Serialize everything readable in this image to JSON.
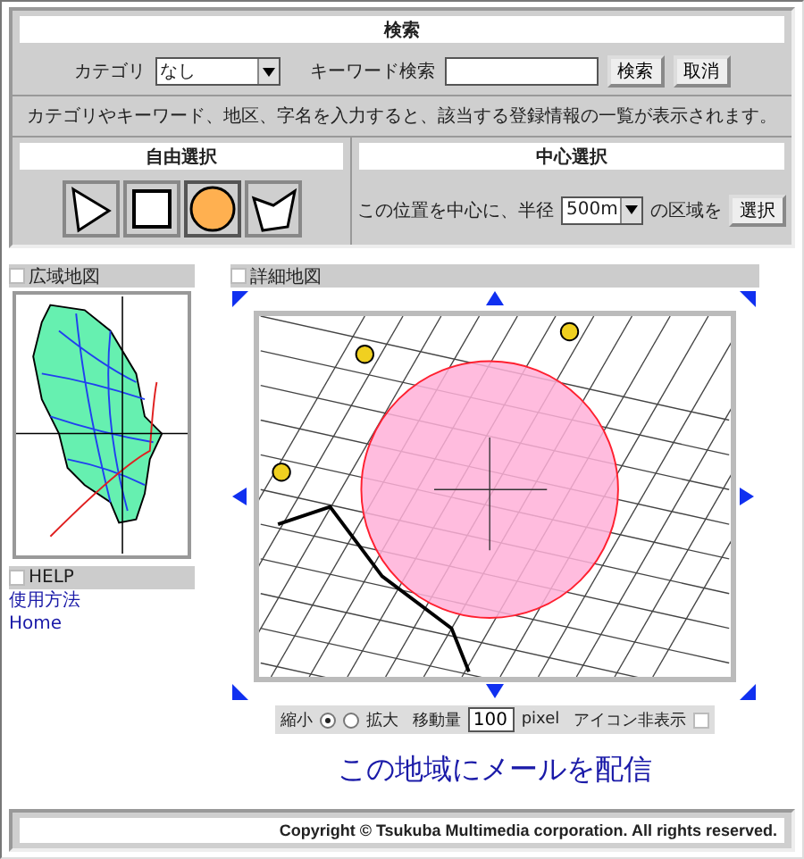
{
  "search": {
    "title": "検索",
    "category_label": "カテゴリ",
    "category_value": "なし",
    "keyword_label": "キーワード検索",
    "buttons": [
      "検索",
      "取消"
    ],
    "description": "カテゴリやキーワード、地区、字名を入力すると、該当する登録情報の一覧が表示されます。"
  },
  "free_select": {
    "title": "自由選択",
    "tools": [
      {
        "kind": "pointer",
        "selected": false
      },
      {
        "kind": "rectangle",
        "selected": false
      },
      {
        "kind": "circle",
        "selected": true
      },
      {
        "kind": "polygon",
        "selected": false
      }
    ]
  },
  "center_select": {
    "title": "中心選択",
    "text_before": "この位置を中心に、半径",
    "radius": "500m",
    "text_after": "の区域を",
    "button": "選択"
  },
  "overview": {
    "title": "広域地図",
    "checked": false
  },
  "help": {
    "title": "HELP",
    "checked": false,
    "links": [
      "使用方法",
      "Home"
    ]
  },
  "detail": {
    "title": "詳細地図",
    "checked": false
  },
  "controls": {
    "zoom_options": [
      {
        "label": "縮小",
        "selected": true
      },
      {
        "label": "拡大",
        "selected": false
      }
    ],
    "move_label": "移動量",
    "move_value": "100",
    "move_unit": "pixel",
    "hide_icons_label": "アイコン非表示",
    "hide_icons": false
  },
  "mail_link": "この地域にメールを配信",
  "footer": "Copyright © Tsukuba Multimedia corporation. All rights reserved."
}
